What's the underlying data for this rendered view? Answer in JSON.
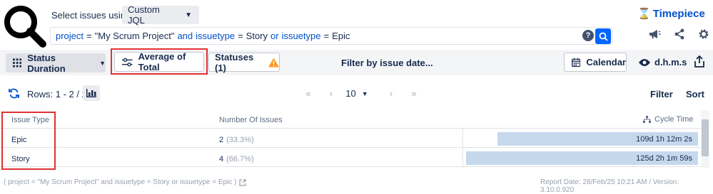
{
  "selector": {
    "label": "Select issues using",
    "mode": "Custom JQL"
  },
  "brand": {
    "name": "Timepiece"
  },
  "query": {
    "f1": "project",
    "op1": "=",
    "v1": "\"My Scrum Project\"",
    "j1": "and",
    "f2": "issuetype",
    "op2": "=",
    "v2": "Story",
    "j2": "or",
    "f3": "issuetype",
    "op3": "=",
    "v3": "Epic",
    "help": "?"
  },
  "toolbar": {
    "status_duration": "Status Duration",
    "average": "Average of Total",
    "statuses": "Statuses (1)",
    "filter_date": "Filter by issue date...",
    "calendar": "Calendar",
    "time_format": "d.h.m.s"
  },
  "rows_info": {
    "label": "Rows: 1 - 2 / 2"
  },
  "pager": {
    "first": "«",
    "prev": "‹",
    "page_size": "10",
    "next": "›",
    "last": "»"
  },
  "actions": {
    "filter": "Filter",
    "sort": "Sort"
  },
  "table": {
    "headers": {
      "type": "Issue Type",
      "count": "Number Of Issues",
      "cycle": "Cycle Time"
    },
    "rows": [
      {
        "type": "Epic",
        "count": "2",
        "pct": "(33.3%)",
        "cycle": "109d 1h 12m 2s",
        "cycle_fraction": 0.866
      },
      {
        "type": "Story",
        "count": "4",
        "pct": "(66.7%)",
        "cycle": "125d 2h 1m 59s",
        "cycle_fraction": 1.0
      }
    ]
  },
  "footer": {
    "query": "( project = \"My Scrum Project\" and issuetype = Story or issuetype = Epic )",
    "report": "Report Date: 28/Feb/25 10:21 AM / Version: 3.10.0.920"
  },
  "colors": {
    "accent": "#0052cc",
    "highlight": "#e03131",
    "bar": "#c6d8ec",
    "warning": "#ff991f"
  },
  "icons": [
    "search-magnifier-logo",
    "chevron-down-icon",
    "hourglass-icon",
    "help-icon",
    "search-icon",
    "megaphone-icon",
    "share-icon",
    "gear-icon",
    "grid-icon",
    "sliders-icon",
    "warning-icon",
    "calendar-icon",
    "eye-icon",
    "export-icon",
    "refresh-icon",
    "bar-chart-icon",
    "double-left-icon",
    "left-icon",
    "right-icon",
    "double-right-icon",
    "hierarchy-icon",
    "external-link-icon"
  ]
}
